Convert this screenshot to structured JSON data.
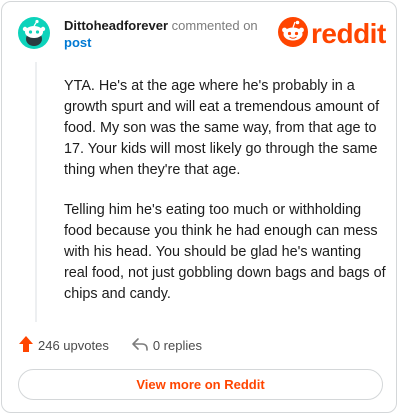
{
  "header": {
    "username": "Dittoheadforever",
    "commented_text": "commented on",
    "post_link": "post",
    "logo_text": "reddit"
  },
  "comment": {
    "paragraphs": [
      "YTA. He's at the age where he's probably in a growth spurt and will eat a tremendous amount of food. My son was the same way, from that age to 17. Your kids will most likely go through the same thing when they're that age.",
      "Telling him he's eating too much or withholding food because you think he had enough can mess with his head. You should be glad he's wanting real food, not just gobbling down bags and bags of chips and candy."
    ]
  },
  "actions": {
    "upvotes": "246 upvotes",
    "replies": "0 replies"
  },
  "footer": {
    "view_more": "View more on Reddit"
  },
  "colors": {
    "brand": "#ff4500",
    "avatar_bg": "#0dd3bb",
    "link": "#0079d3",
    "text": "#1c1c1c",
    "muted": "#7c7c7c"
  },
  "icons": {
    "avatar": "snoo-avatar-icon",
    "logo": "reddit-snoo-icon",
    "upvote": "upvote-arrow-icon",
    "reply": "reply-arrow-icon"
  }
}
